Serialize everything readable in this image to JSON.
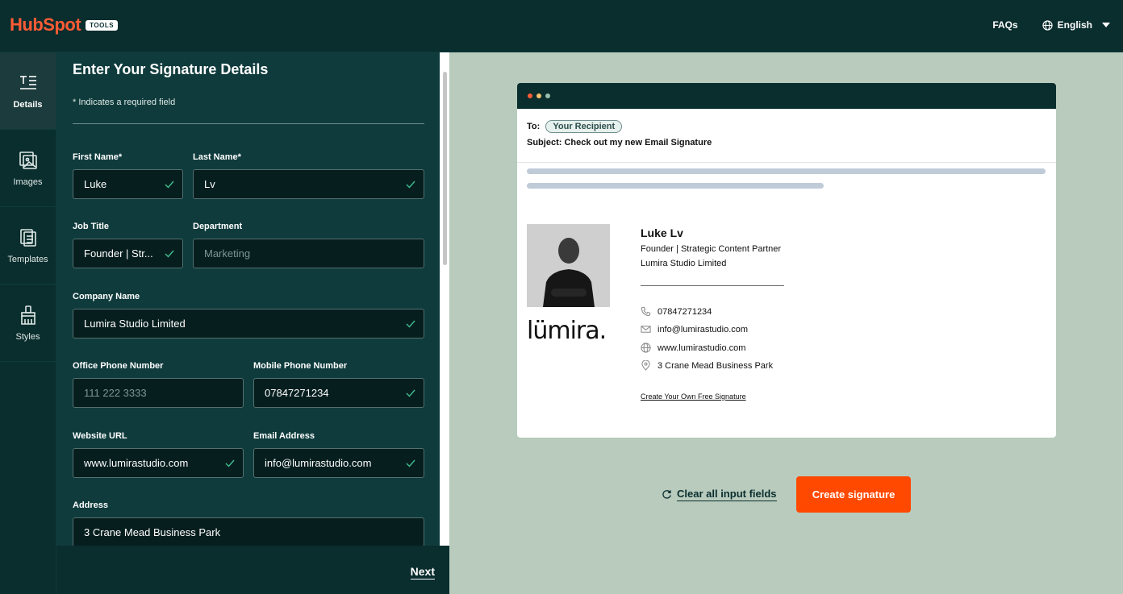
{
  "header": {
    "brand": "HubSpot",
    "badge": "TOOLS",
    "faqs_label": "FAQs",
    "language_label": "English"
  },
  "sidenav": {
    "items": [
      {
        "label": "Details",
        "icon": "text-lines-icon",
        "active": true
      },
      {
        "label": "Images",
        "icon": "image-icon",
        "active": false
      },
      {
        "label": "Templates",
        "icon": "templates-icon",
        "active": false
      },
      {
        "label": "Styles",
        "icon": "brush-icon",
        "active": false
      }
    ]
  },
  "form": {
    "title": "Enter Your Signature Details",
    "required_note": "* Indicates a required field",
    "first_name": {
      "label": "First Name*",
      "value": "Luke"
    },
    "last_name": {
      "label": "Last Name*",
      "value": "Lv"
    },
    "job_title": {
      "label": "Job Title",
      "value": "Founder | Str..."
    },
    "department": {
      "label": "Department",
      "placeholder": "Marketing"
    },
    "company_name": {
      "label": "Company Name",
      "value": "Lumira Studio Limited"
    },
    "office_phone": {
      "label": "Office Phone Number",
      "placeholder": "111 222 3333"
    },
    "mobile_phone": {
      "label": "Mobile Phone Number",
      "value": "07847271234"
    },
    "website": {
      "label": "Website URL",
      "value": "www.lumirastudio.com"
    },
    "email": {
      "label": "Email Address",
      "value": "info@lumirastudio.com"
    },
    "address": {
      "label": "Address",
      "value": "3 Crane Mead Business Park"
    },
    "next_label": "Next"
  },
  "preview": {
    "to_label": "To:",
    "recipient": "Your Recipient",
    "subject": "Subject: Check out my new Email Signature",
    "brand_logo": "lümira.",
    "name": "Luke Lv",
    "title": "Founder | Strategic Content Partner",
    "company": "Lumira Studio Limited",
    "phone": "07847271234",
    "email": "info@lumirastudio.com",
    "website": "www.lumirastudio.com",
    "address": "3 Crane Mead Business Park",
    "create_own_link": "Create Your Own Free Signature"
  },
  "actions": {
    "clear_label": "Clear all input fields",
    "create_label": "Create signature"
  },
  "colors": {
    "dark_teal": "#0a2d2e",
    "panel_teal": "#0f3b3c",
    "accent_orange": "#ff4800",
    "preview_bg": "#b8cbbd",
    "check_green": "#3fbf8f"
  }
}
